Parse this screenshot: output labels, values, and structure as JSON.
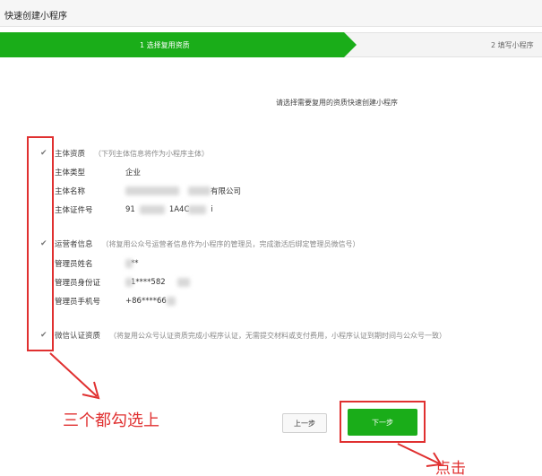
{
  "header": {
    "title": "快速创建小程序"
  },
  "steps": [
    {
      "label": "1 选择复用资质"
    },
    {
      "label": "2 填写小程序"
    }
  ],
  "intro": "请选择需要复用的资质快速创建小程序",
  "sections": {
    "subject": {
      "title": "主体资质",
      "note": "（下列主体信息将作为小程序主体）",
      "fields": [
        {
          "label": "主体类型",
          "value": "企业"
        },
        {
          "label": "主体名称",
          "value": "有限公司"
        },
        {
          "label": "主体证件号",
          "value": "91",
          "value2": "1A4C",
          "value3": "i"
        }
      ]
    },
    "operator": {
      "title": "运营者信息",
      "note": "（将复用公众号运营者信息作为小程序的管理员，完成激活后绑定管理员微信号）",
      "fields": [
        {
          "label": "管理员姓名",
          "value": "**"
        },
        {
          "label": "管理员身份证",
          "value": "1****582"
        },
        {
          "label": "管理员手机号",
          "value": "+86****66"
        }
      ]
    },
    "cert": {
      "title": "微信认证资质",
      "note": "（将复用公众号认证资质完成小程序认证，无需提交材料或支付费用，小程序认证到期时间与公众号一致）"
    }
  },
  "annotations": {
    "check_all": "三个都勾选上",
    "click": "点击"
  },
  "buttons": {
    "prev": "上一步",
    "next": "下一步"
  },
  "colors": {
    "accent": "#1aad19",
    "annotation": "#e03030"
  }
}
